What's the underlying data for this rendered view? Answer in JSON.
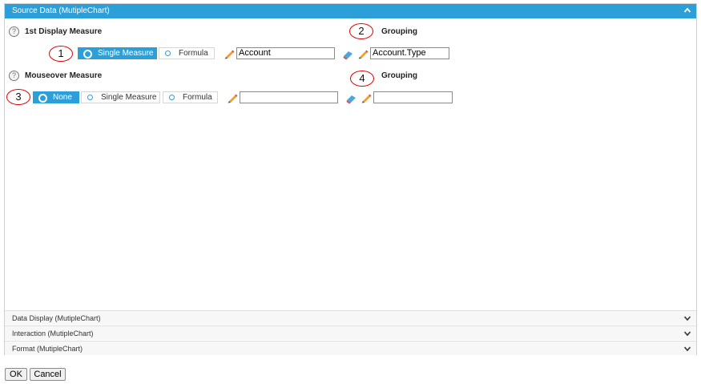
{
  "panel": {
    "title": "Source Data (MutipleChart)"
  },
  "first_measure": {
    "label": "1st Display Measure",
    "help_symbol": "?",
    "callout": "1",
    "options": [
      "Single Measure",
      "Formula"
    ],
    "selected": "Single Measure",
    "value": "Account"
  },
  "grouping1": {
    "label": "Grouping",
    "callout": "2",
    "value": "Account.Type"
  },
  "mouseover": {
    "label": "Mouseover Measure",
    "help_symbol": "?",
    "callout": "3",
    "options": [
      "None",
      "Single Measure",
      "Formula"
    ],
    "selected": "None",
    "value": ""
  },
  "grouping2": {
    "label": "Grouping",
    "callout": "4",
    "value": ""
  },
  "sections": [
    "Data Display (MutipleChart)",
    "Interaction (MutipleChart)",
    "Format (MutipleChart)"
  ],
  "buttons": {
    "ok": "OK",
    "cancel": "Cancel"
  },
  "colors": {
    "accent": "#2c9fd9",
    "callout_border": "#dd0000"
  },
  "icons": {
    "pencil": "pencil-icon",
    "eraser": "eraser-icon",
    "help": "help-icon",
    "chevron": "chevron-icon"
  }
}
